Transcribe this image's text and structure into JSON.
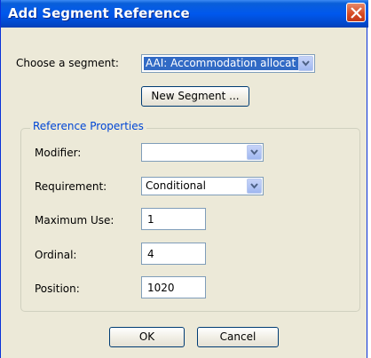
{
  "window": {
    "title": "Add Segment Reference",
    "close_icon": "close-icon"
  },
  "segment": {
    "label": "Choose a segment:",
    "selected": "AAI: Accommodation allocat",
    "new_button": "New Segment ..."
  },
  "properties": {
    "group_label": "Reference Properties",
    "modifier": {
      "label": "Modifier:",
      "value": ""
    },
    "requirement": {
      "label": "Requirement:",
      "value": "Conditional"
    },
    "maximum_use": {
      "label": "Maximum Use:",
      "value": "1"
    },
    "ordinal": {
      "label": "Ordinal:",
      "value": "4"
    },
    "position": {
      "label": "Position:",
      "value": "1020"
    }
  },
  "buttons": {
    "ok": "OK",
    "cancel": "Cancel"
  },
  "colors": {
    "titlebar": "#0058ee",
    "dialog_bg": "#ece9d8",
    "group_label": "#0046d5",
    "selection": "#316ac5"
  }
}
